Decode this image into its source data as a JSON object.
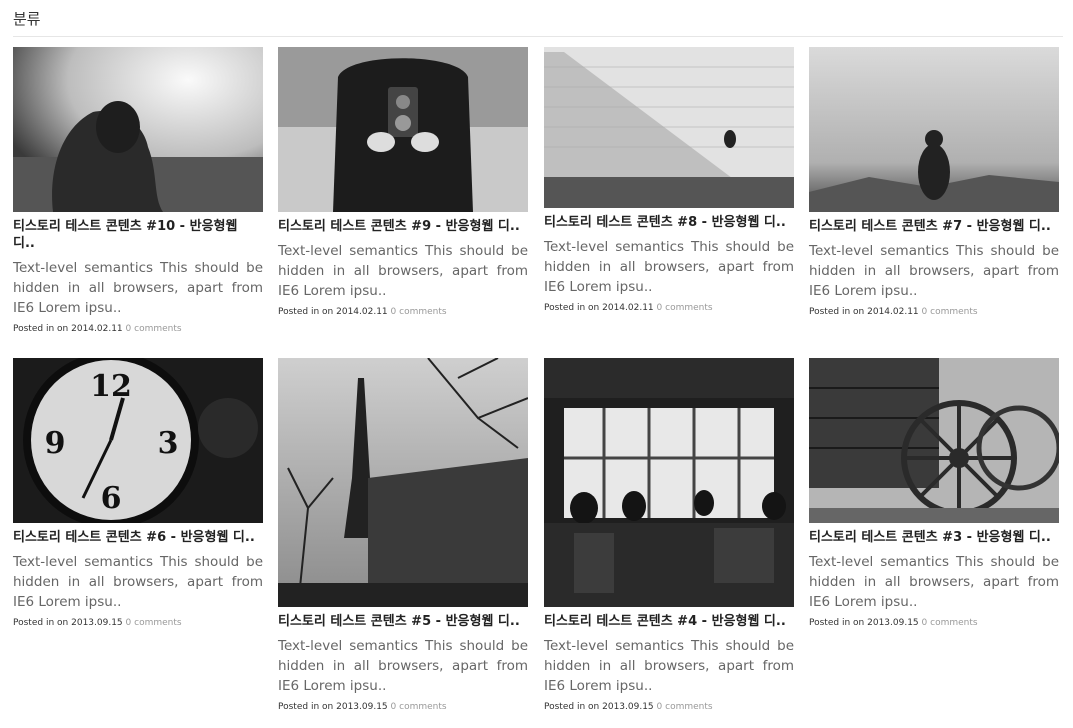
{
  "header": {
    "title": "분류"
  },
  "meta_labels": {
    "posted": "Posted in",
    "on": "on"
  },
  "posts": [
    {
      "title": "티스토리 테스트 콘텐츠 #10 - 반응형웹 디..",
      "excerpt": "Text-level semantics This should be hidden in all browsers, apart from IE6 Lorem ipsu..",
      "date": "2014.02.11",
      "comments": "0 comments",
      "image_icon": "girl-in-field-photo"
    },
    {
      "title": "티스토리 테스트 콘텐츠 #9 - 반응형웹 디..",
      "excerpt": "Text-level semantics This should be hidden in all browsers, apart from IE6 Lorem ipsu..",
      "date": "2014.02.11",
      "comments": "0 comments",
      "image_icon": "camera-photographer-photo"
    },
    {
      "title": "티스토리 테스트 콘텐츠 #8 - 반응형웹 디..",
      "excerpt": "Text-level semantics This should be hidden in all browsers, apart from IE6 Lorem ipsu..",
      "date": "2014.02.11",
      "comments": "0 comments",
      "image_icon": "stone-stairs-photo"
    },
    {
      "title": "티스토리 테스트 콘텐츠 #7 - 반응형웹 디..",
      "excerpt": "Text-level semantics This should be hidden in all browsers, apart from IE6 Lorem ipsu..",
      "date": "2014.02.11",
      "comments": "0 comments",
      "image_icon": "couple-hilltop-photo"
    },
    {
      "title": "티스토리 테스트 콘텐츠 #6 - 반응형웹 디..",
      "excerpt": "Text-level semantics This should be hidden in all browsers, apart from IE6 Lorem ipsu..",
      "date": "2013.09.15",
      "comments": "0 comments",
      "image_icon": "alarm-clock-photo"
    },
    {
      "title": "티스토리 테스트 콘텐츠 #5 - 반응형웹 디..",
      "excerpt": "Text-level semantics This should be hidden in all browsers, apart from IE6 Lorem ipsu..",
      "date": "2013.09.15",
      "comments": "0 comments",
      "image_icon": "eiffel-tower-photo"
    },
    {
      "title": "티스토리 테스트 콘텐츠 #4 - 반응형웹 디..",
      "excerpt": "Text-level semantics This should be hidden in all browsers, apart from IE6 Lorem ipsu..",
      "date": "2013.09.15",
      "comments": "0 comments",
      "image_icon": "cafe-interior-photo"
    },
    {
      "title": "티스토리 테스트 콘텐츠 #3 - 반응형웹 디..",
      "excerpt": "Text-level semantics This should be hidden in all browsers, apart from IE6 Lorem ipsu..",
      "date": "2013.09.15",
      "comments": "0 comments",
      "image_icon": "wagon-wheel-photo"
    }
  ]
}
